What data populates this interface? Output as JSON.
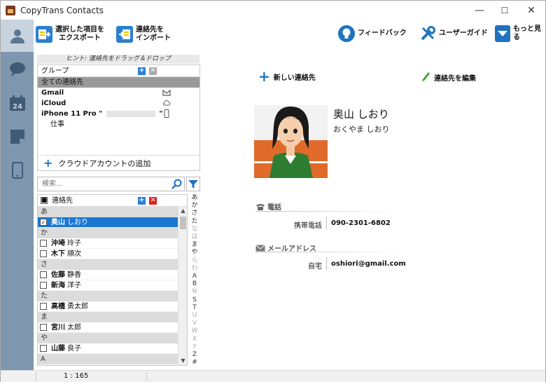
{
  "window": {
    "title": "CopyTrans Contacts",
    "minimize": "—",
    "maximize": "☐",
    "close": "✕"
  },
  "rail": {
    "items": [
      "contacts",
      "messages",
      "calendar",
      "notes",
      "device"
    ],
    "calendar_day": "24",
    "active": "contacts"
  },
  "toolbar": {
    "export_line1": "選択した項目を",
    "export_line2": "エクスポート",
    "import_line1": "連絡先を",
    "import_line2": "インポート",
    "feedback": "フィードバック",
    "guide": "ユーザーガイド",
    "more": "もっと見る"
  },
  "hint": "ヒント: 連絡先をドラッグ＆ドロップ",
  "groups": {
    "header": "グループ",
    "rows": [
      {
        "label": "全ての連絡先",
        "selected": true
      },
      {
        "label": "Gmail",
        "icon": "gmail-icon"
      },
      {
        "label": "iCloud",
        "icon": "cloud-icon"
      },
      {
        "label": "iPhone 11 Pro \"",
        "suffix": "\"",
        "icon": "phone-icon"
      },
      {
        "label": "仕事"
      }
    ],
    "add_cloud": "クラウドアカウントの追加"
  },
  "search": {
    "placeholder": "検索..."
  },
  "contacts": {
    "header": "連絡先",
    "sections": [
      {
        "kana": "あ",
        "items": [
          {
            "last": "奥山",
            "first": "しおり",
            "selected": true
          }
        ]
      },
      {
        "kana": "か",
        "items": [
          {
            "last": "沖埼",
            "first": "玲子"
          },
          {
            "last": "木下",
            "first": "順次"
          }
        ]
      },
      {
        "kana": "さ",
        "items": [
          {
            "last": "佐藤",
            "first": "静香"
          },
          {
            "last": "新海",
            "first": "洋子"
          }
        ]
      },
      {
        "kana": "た",
        "items": [
          {
            "last": "高橋",
            "first": "勇太郎"
          }
        ]
      },
      {
        "kana": "ま",
        "items": [
          {
            "last": "宮川",
            "first": "太郎"
          }
        ]
      },
      {
        "kana": "や",
        "items": [
          {
            "last": "山藤",
            "first": "良子"
          }
        ]
      },
      {
        "kana": "A",
        "items": []
      }
    ]
  },
  "alphabet": [
    "あ",
    "か",
    "さ",
    "た",
    "な",
    "は",
    "ま",
    "や",
    "ら",
    "わ",
    "A",
    "B",
    "N",
    "S",
    "T",
    "U",
    "V",
    "W",
    "X",
    "Y",
    "Z",
    "#"
  ],
  "alphabet_dim": [
    "な",
    "は",
    "ら",
    "わ",
    "N",
    "U",
    "V",
    "W",
    "X",
    "Y"
  ],
  "detail": {
    "new_contact": "新しい連絡先",
    "edit_contact": "連絡先を編集",
    "name": "奥山 しおり",
    "kana": "おくやま しおり",
    "phone_section": "電話",
    "phone_label": "携帯電話",
    "phone_value": "090-2301-6802",
    "email_section": "メールアドレス",
    "email_label": "自宅",
    "email_value": "oshiori@gmail.com"
  },
  "status": {
    "count": "1 : 165"
  },
  "colors": {
    "rail": "#7e96ae",
    "selected_blue": "#1a78d4",
    "icon_blue": "#1e73be"
  }
}
